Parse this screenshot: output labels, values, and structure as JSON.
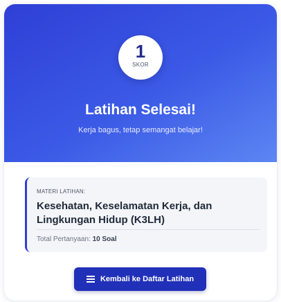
{
  "score": {
    "value": "1",
    "label": "SKOR"
  },
  "result": {
    "title": "Latihan Selesai!",
    "subtitle": "Kerja bagus, tetap semangat belajar!"
  },
  "materi": {
    "label": "MATERI LATIHAN:",
    "title": "Kesehatan, Keselamatan Kerja, dan Lingkungan Hidup (K3LH)",
    "total_label": "Total Pertanyaan:",
    "total_value": "10 Soal"
  },
  "actions": {
    "back_label": "Kembali ke Daftar Latihan",
    "back_icon": "list-icon"
  },
  "colors": {
    "header_start": "#2f3fd6",
    "header_end": "#5d86f3",
    "button": "#2130b8"
  }
}
